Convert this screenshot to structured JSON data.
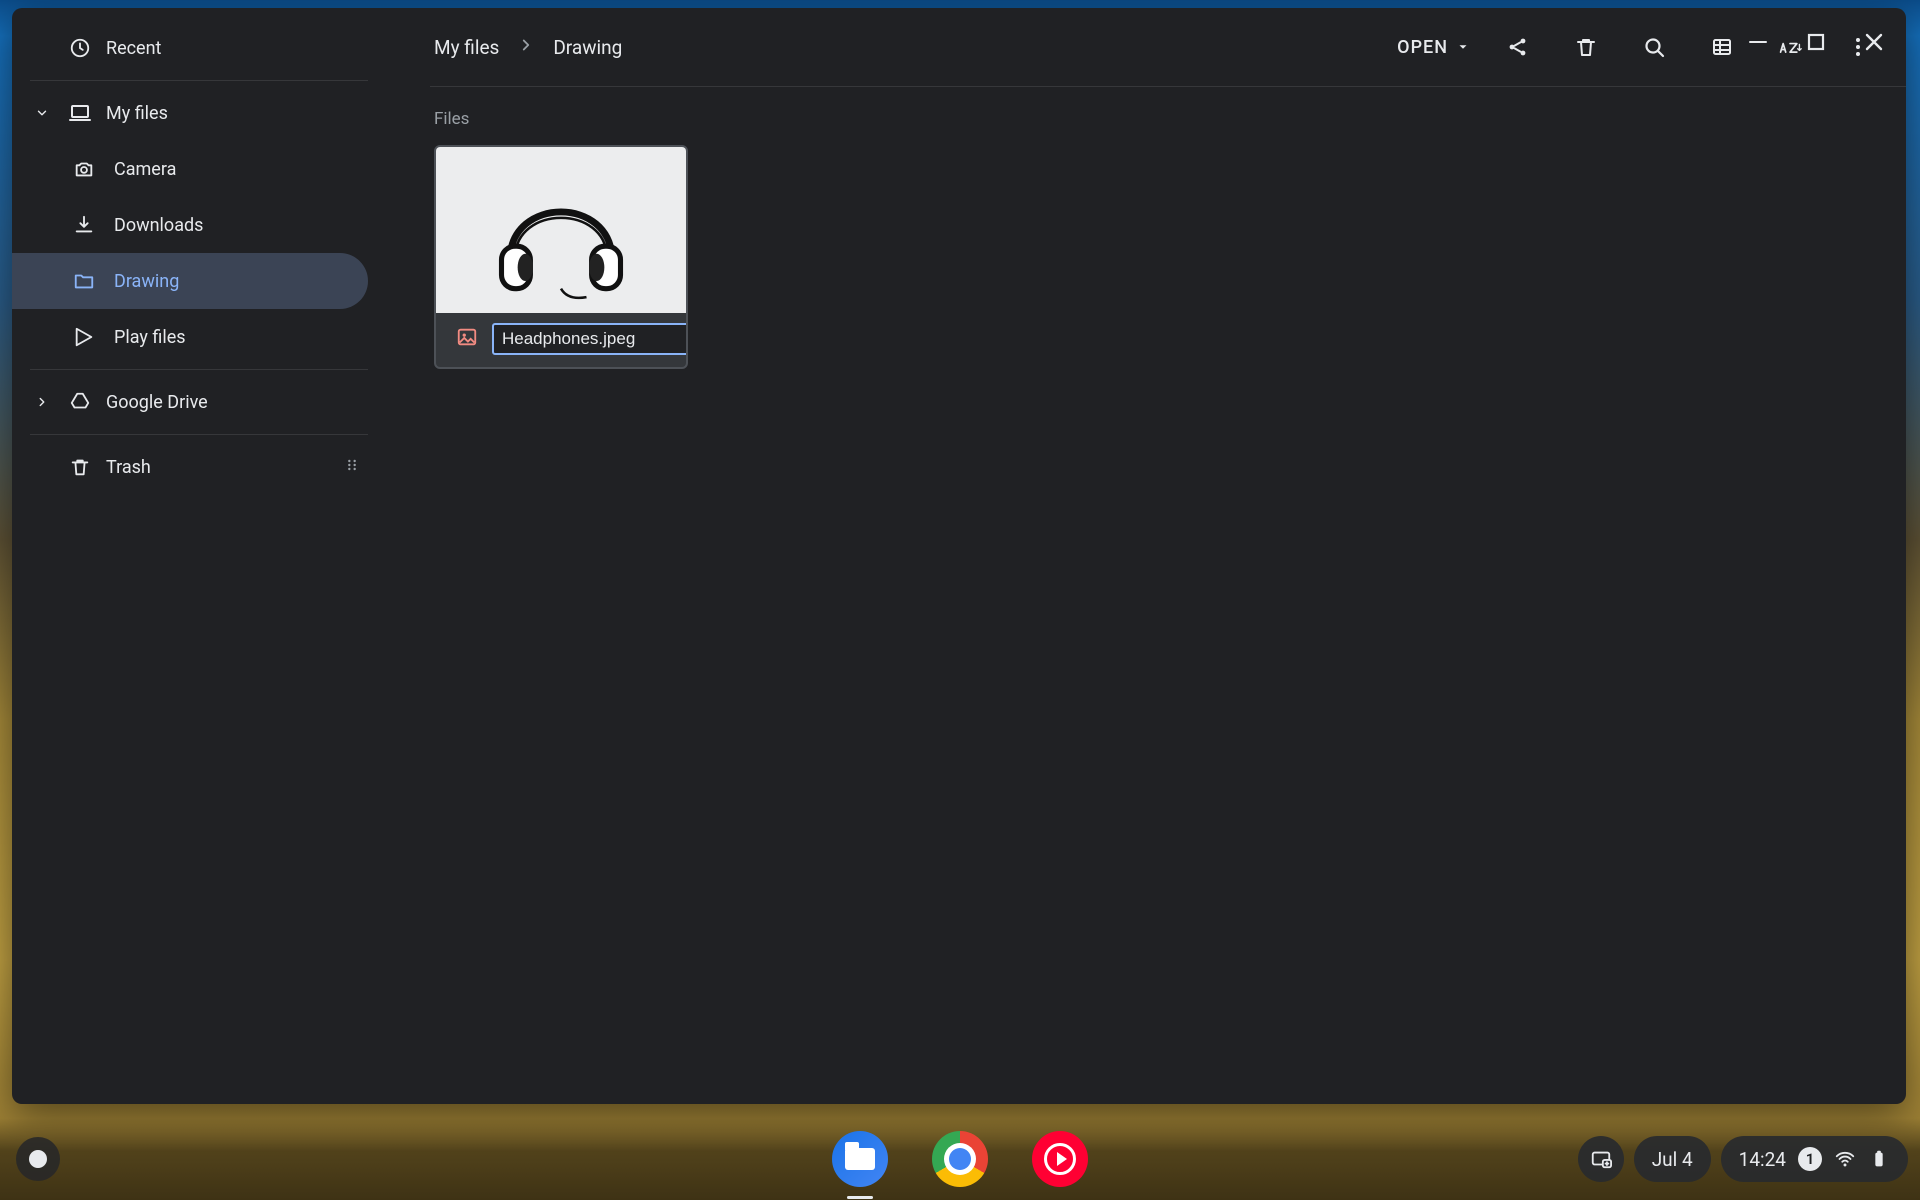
{
  "sidebar": {
    "recent_label": "Recent",
    "my_files_label": "My files",
    "children": {
      "camera": "Camera",
      "downloads": "Downloads",
      "drawing": "Drawing",
      "play_files": "Play files"
    },
    "google_drive_label": "Google Drive",
    "trash_label": "Trash"
  },
  "breadcrumb": {
    "root": "My files",
    "current": "Drawing"
  },
  "toolbar": {
    "open_label": "OPEN"
  },
  "section_label": "Files",
  "file": {
    "name": "Headphones.jpeg"
  },
  "shelf": {
    "date": "Jul 4",
    "time": "14:24",
    "notification_count": "1"
  }
}
